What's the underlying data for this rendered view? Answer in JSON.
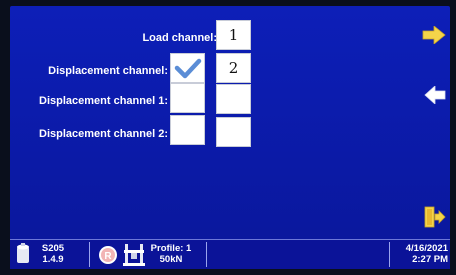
{
  "fields": [
    {
      "label": "Load channel:",
      "value": "1",
      "checked": false
    },
    {
      "label": "Displacement channel:",
      "value": "2",
      "checked": true
    },
    {
      "label": "Displacement channel 1:",
      "value": "",
      "checked": false
    },
    {
      "label": "Displacement channel 2:",
      "value": "",
      "checked": false
    }
  ],
  "nav": {
    "next_icon": "arrow-right-icon",
    "back_icon": "arrow-left-icon",
    "exit_icon": "exit-door-icon",
    "next_color": "#f4d44a",
    "exit_color": "#f4d44a"
  },
  "statusbar": {
    "model": "S205",
    "version": "1.4.9",
    "profile": "Profile: 1",
    "load": "50kN",
    "date": "4/16/2021",
    "time": "2:27 PM"
  }
}
